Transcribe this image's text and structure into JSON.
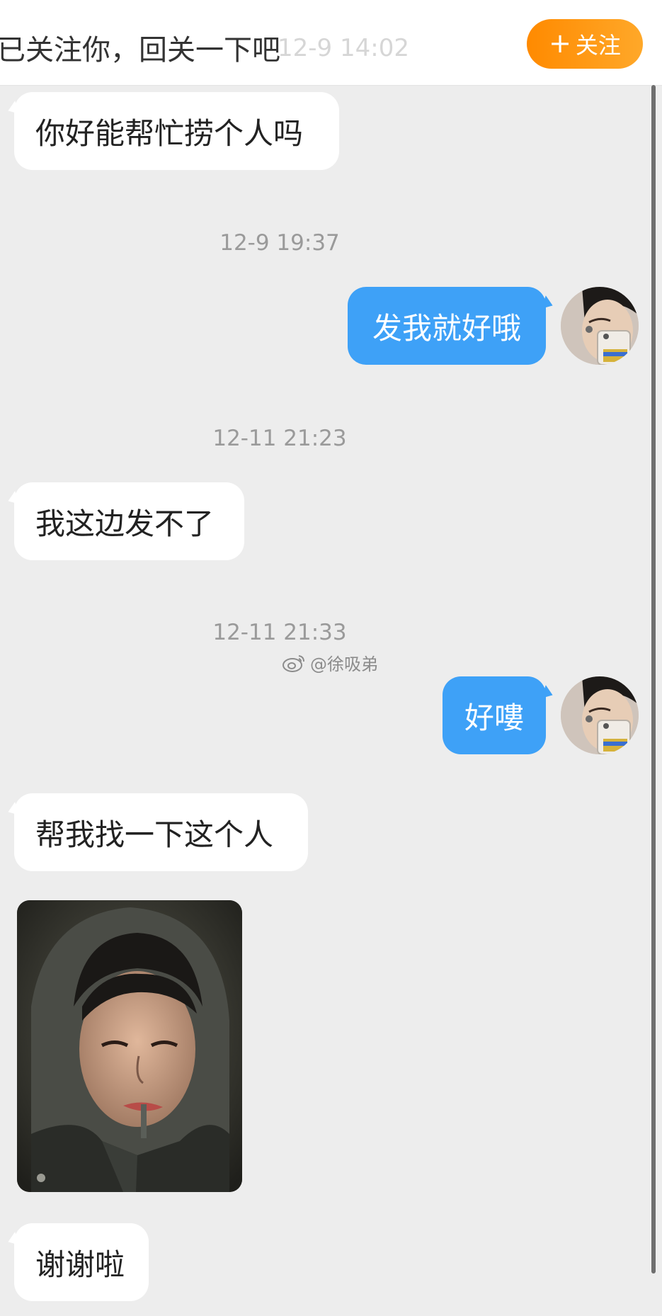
{
  "header": {
    "banner_text": "已关注你，回关一下吧",
    "faded_time": "12-9 14:02",
    "follow_button": {
      "plus_icon": "+",
      "label": "关注",
      "accent_color": "#ff8a00"
    }
  },
  "messages": [
    {
      "type": "incoming",
      "text": "你好能帮忙捞个人吗"
    },
    {
      "type": "timestamp",
      "text": "12-9 19:37"
    },
    {
      "type": "outgoing",
      "text": "发我就好哦"
    },
    {
      "type": "timestamp",
      "text": "12-11 21:23"
    },
    {
      "type": "incoming",
      "text": "我这边发不了"
    },
    {
      "type": "timestamp",
      "text": "12-11 21:33"
    },
    {
      "type": "outgoing",
      "text": "好嘍"
    },
    {
      "type": "incoming",
      "text": "帮我找一下这个人"
    },
    {
      "type": "incoming_image",
      "icon": "photo-of-person"
    },
    {
      "type": "incoming",
      "text": "谢谢啦"
    }
  ],
  "watermark": {
    "icon": "weibo-logo-icon",
    "text": "@徐吸弟"
  },
  "colors": {
    "outgoing_bubble": "#3ea1f7",
    "incoming_bubble": "#ffffff",
    "chat_background": "#ededed"
  }
}
